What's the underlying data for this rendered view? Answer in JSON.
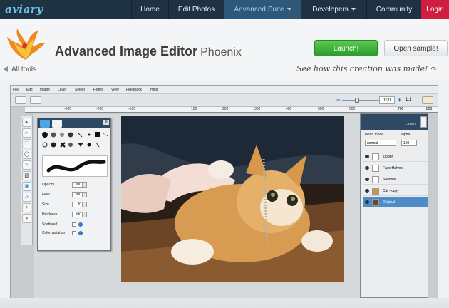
{
  "nav": {
    "logo": "aviary",
    "items": [
      {
        "label": "Home"
      },
      {
        "label": "Edit Photos"
      },
      {
        "label": "Advanced Suite"
      },
      {
        "label": "Developers"
      },
      {
        "label": "Community"
      },
      {
        "label": "Login"
      }
    ]
  },
  "header": {
    "title": "Advanced Image Editor",
    "subtitle": "Phoenix",
    "launch_label": "Launch!",
    "sample_label": "Open sample!",
    "all_tools": "All tools",
    "see_how": "See how this creation was made!"
  },
  "editor": {
    "menu": [
      "File",
      "Edit",
      "Image",
      "Layer",
      "Select",
      "Filters",
      "View",
      "Feedback",
      "Help"
    ],
    "zoom": {
      "value": "100",
      "reset_label": "1:1"
    },
    "ruler_ticks": [
      "-300",
      "-200",
      "-100",
      "100",
      "200",
      "300",
      "400",
      "500",
      "600",
      "700",
      "800"
    ],
    "brush_panel": {
      "opacity": {
        "label": "Opacity",
        "value": "100"
      },
      "flow": {
        "label": "Flow",
        "value": "100"
      },
      "size": {
        "label": "Size",
        "value": "20"
      },
      "hardness": {
        "label": "Hardness",
        "value": "100"
      },
      "scattered": {
        "label": "Scattered"
      },
      "color_variation": {
        "label": "Color variation"
      }
    },
    "layers_panel": {
      "title": "Layers",
      "blend_label": "blend mode",
      "blend_value": "normal",
      "alpha_label": "alpha",
      "alpha_value": "100",
      "layers": [
        {
          "name": "Zipper",
          "selected": false
        },
        {
          "name": "Face Halves",
          "selected": false
        },
        {
          "name": "Shadow",
          "selected": false
        },
        {
          "name": "Cat - copy",
          "selected": false
        },
        {
          "name": "Original",
          "selected": true
        }
      ]
    }
  },
  "colors": {
    "nav_bg": "#1f3244",
    "nav_active": "#2f5778",
    "login": "#d01c3f",
    "launch": "#3aa836",
    "panel_head": "#2d4963",
    "layer_selected": "#4d8cc9"
  }
}
